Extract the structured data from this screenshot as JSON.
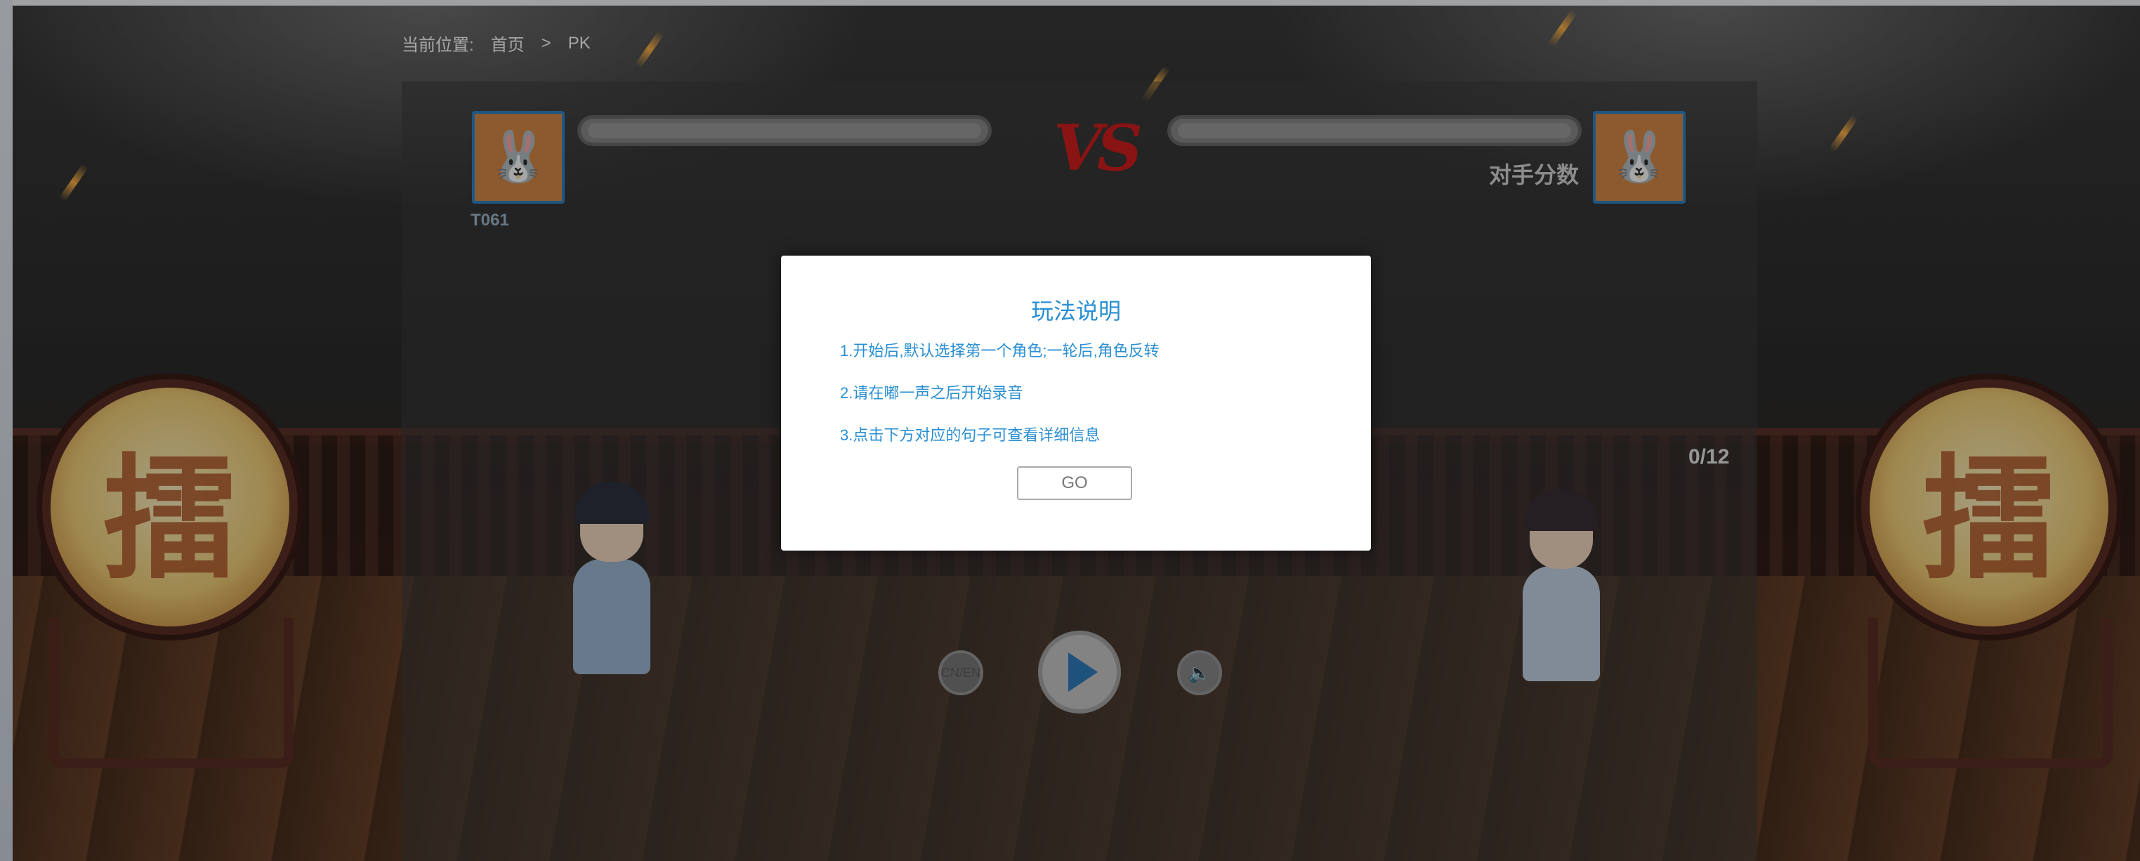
{
  "breadcrumb": {
    "label": "当前位置:",
    "home": "首页",
    "separator": ">",
    "current": "PK"
  },
  "game": {
    "player_name": "T061",
    "opponent_score_label": "对手分数",
    "vs_label": "VS",
    "progress_counter": "0/12",
    "drum_char": "擂",
    "player_progress": 0,
    "opponent_progress": 0
  },
  "controls": {
    "lang_toggle": "CN/EN",
    "volume_icon": "🔈"
  },
  "modal": {
    "title": "玩法说明",
    "rules": [
      "1.开始后,默认选择第一个角色;一轮后,角色反转",
      "2.请在嘟一声之后开始录音",
      "3.点击下方对应的句子可查看详细信息"
    ],
    "go_label": "GO"
  },
  "colors": {
    "accent": "#2a8fd2",
    "vs_red": "#d41e1e",
    "avatar_border": "#2f86c9"
  }
}
